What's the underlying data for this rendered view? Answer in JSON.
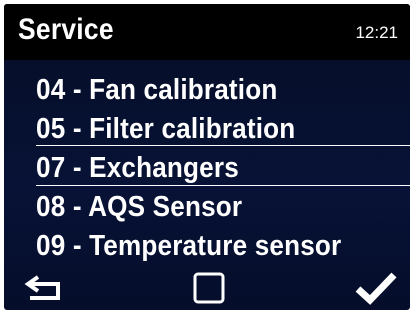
{
  "header": {
    "title": "Service",
    "time": "12:21"
  },
  "menu": {
    "items": [
      {
        "label": "04 - Fan calibration",
        "selected": false
      },
      {
        "label": "05 - Filter calibration",
        "selected": false
      },
      {
        "label": "07 - Exchangers",
        "selected": true
      },
      {
        "label": "08 - AQS Sensor",
        "selected": false
      },
      {
        "label": "09 - Temperature sensor",
        "selected": false
      }
    ]
  },
  "footer": {
    "back_icon": "back-arrow-icon",
    "home_icon": "square-icon",
    "confirm_icon": "checkmark-icon"
  },
  "colors": {
    "background": "#06102e",
    "header": "#000000",
    "text": "#ffffff"
  }
}
